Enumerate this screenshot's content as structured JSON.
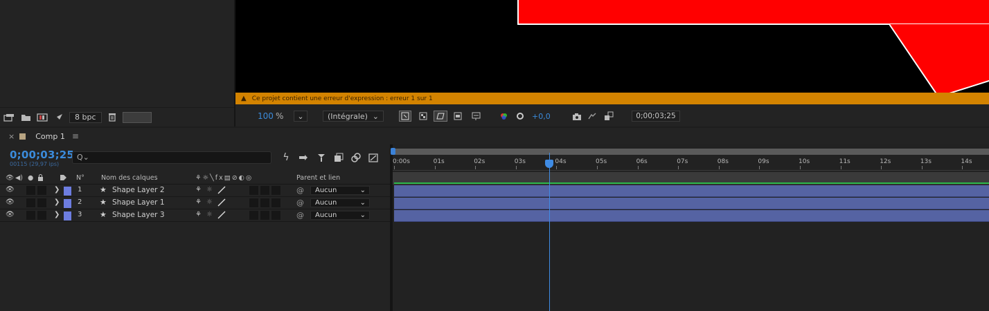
{
  "project": {
    "bpc": "8 bpc",
    "toolbar_icons": [
      "interpret-footage-icon",
      "folder-icon",
      "new-composition-icon",
      "flowchart-icon"
    ]
  },
  "viewer": {
    "warning": "Ce projet contient une erreur d'expression : erreur 1 sur 1",
    "zoom": "100",
    "zoom_unit": "%",
    "resolution": "(Intégrale)",
    "exposure": "+0,0",
    "timecode": "0;00;03;25",
    "colors": {
      "canvas": "#000000",
      "shape": "#ff0000",
      "warning": "#d38300"
    }
  },
  "timeline": {
    "tab_close": "×",
    "comp_name": "Comp 1",
    "timecode": "0;00;03;25",
    "fps": "00115 (29,97 ips)",
    "columns": {
      "number": "N°",
      "layer_name": "Nom des calques",
      "parent": "Parent et lien"
    },
    "layers": [
      {
        "num": "1",
        "name": "Shape Layer 2",
        "parent": "Aucun"
      },
      {
        "num": "2",
        "name": "Shape Layer 1",
        "parent": "Aucun"
      },
      {
        "num": "3",
        "name": "Shape Layer 3",
        "parent": "Aucun"
      }
    ],
    "ruler_labels": [
      "0:00s",
      "01s",
      "02s",
      "03s",
      "04s",
      "05s",
      "06s",
      "07s",
      "08s",
      "09s",
      "10s",
      "11s",
      "12s",
      "13s",
      "14s"
    ],
    "playhead_seconds": 3.83,
    "colors": {
      "timecode": "#3b8bdb",
      "layer_label": "#6d7de0",
      "track": "#5563a3",
      "playhead": "#3f8be4",
      "work_area": "#2bb84a"
    }
  }
}
